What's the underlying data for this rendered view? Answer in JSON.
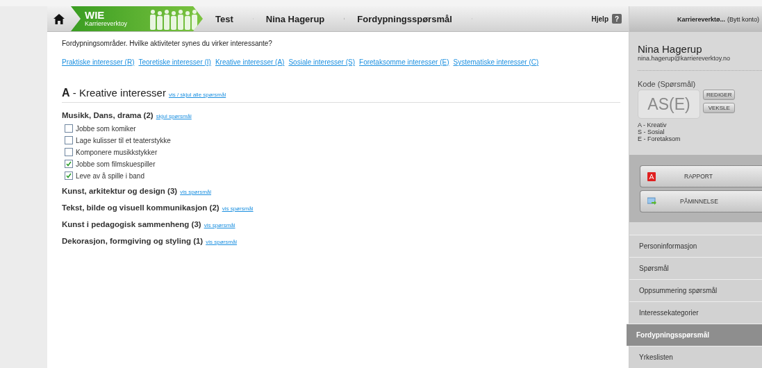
{
  "breadcrumb": {
    "logo": {
      "title": "WIE",
      "subtitle": "Karriereverktoy"
    },
    "items": [
      "Test",
      "Nina Hagerup",
      "Fordypningsspørsmål"
    ],
    "help": "Hjelp",
    "help_icon": "?"
  },
  "intro": "Fordypningsområder. Hvilke aktiviteter synes du virker interessante?",
  "category_links": [
    "Praktiske interesser (R)",
    "Teoretiske interesser (I)",
    "Kreative interesser (A)",
    "Sosiale interesser (S)",
    "Foretaksomme interesser (E)",
    "Systematiske interesser (C)"
  ],
  "section": {
    "letter": "A",
    "title": " - Kreative interesser",
    "toggle_link": "vis / skjul alle spørsmål"
  },
  "groups": [
    {
      "title": "Musikk, Dans, drama (2)",
      "link": "skjul spørsmål",
      "questions": [
        {
          "label": "Jobbe som komiker",
          "checked": false
        },
        {
          "label": "Lage kulisser til et teaterstykke",
          "checked": false
        },
        {
          "label": "Komponere musikkstykker",
          "checked": false
        },
        {
          "label": "Jobbe som filmskuespiller",
          "checked": true
        },
        {
          "label": "Leve av å spille i band",
          "checked": true
        }
      ]
    },
    {
      "title": "Kunst, arkitektur og design (3)",
      "link": "vis spørsmål"
    },
    {
      "title": "Tekst, bilde og visuell kommunikasjon (2)",
      "link": "vis spørsmål"
    },
    {
      "title": "Kunst i pedagogisk sammenheng (3)",
      "link": "vis spørsmål"
    },
    {
      "title": "Dekorasjon, formgiving og styling (1)",
      "link": "vis spørsmål"
    }
  ],
  "sidebar": {
    "account": "Karriereverktø...",
    "switch_account": "(Bytt konto)",
    "name": "Nina Hagerup",
    "email": "nina.hagerup@karriereverktoy.no",
    "code_label": "Kode (Spørsmål)",
    "code": "AS(E)",
    "code_buttons": [
      "REDIGER",
      "VEKSLE"
    ],
    "code_legend": [
      "A - Kreativ",
      "S - Sosial",
      "E - Foretaksom"
    ],
    "actions": [
      {
        "kind": "pdf",
        "label": "RAPPORT"
      },
      {
        "kind": "mail",
        "label": "PÅMINNELSE"
      }
    ],
    "nav": [
      {
        "label": "Personinformasjon",
        "selected": false
      },
      {
        "label": "Spørsmål",
        "selected": false
      },
      {
        "label": "Oppsummering spørsmål",
        "selected": false
      },
      {
        "label": "Interessekategorier",
        "selected": false
      },
      {
        "label": "Fordypningsspørsmål",
        "selected": true
      },
      {
        "label": "Yrkeslisten",
        "selected": false
      }
    ]
  }
}
